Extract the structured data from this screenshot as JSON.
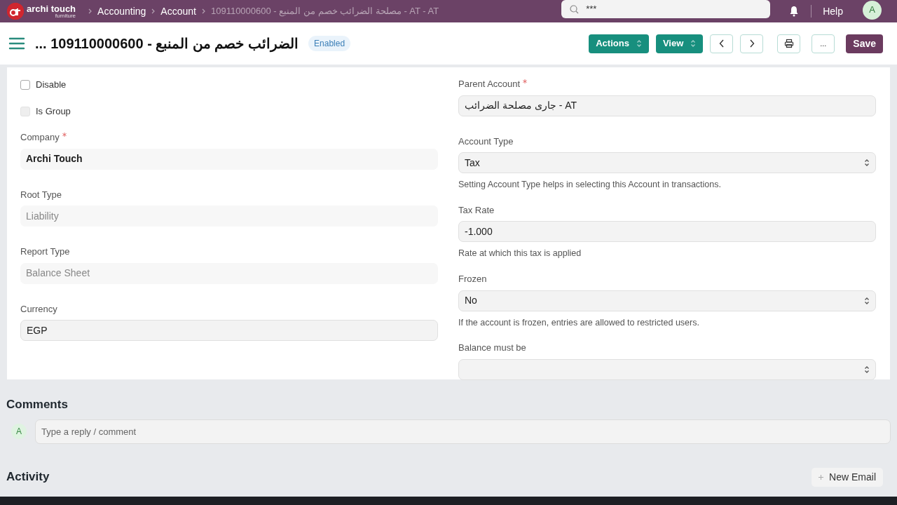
{
  "navbar": {
    "logo_text": "archi touch",
    "logo_subtext": "furniture",
    "breadcrumbs": [
      {
        "label": "Accounting",
        "current": false
      },
      {
        "label": "Account",
        "current": false
      },
      {
        "label": "109110000600 - مصلحة الضرائب خصم من المنبع - AT - AT",
        "current": true
      }
    ],
    "search": {
      "value": "***"
    },
    "help": "Help",
    "avatar": "A"
  },
  "header": {
    "title": "... الضرائب خصم من المنبع - 109110000600",
    "status": "Enabled",
    "buttons": [
      {
        "label": "Actions",
        "kind": "dropdown"
      },
      {
        "label": "View",
        "kind": "dropdown"
      },
      {
        "kind": "prev"
      },
      {
        "kind": "next"
      },
      {
        "kind": "print"
      },
      {
        "label": "...",
        "kind": "more"
      },
      {
        "label": "Save",
        "kind": "primary"
      }
    ]
  },
  "left_fields": [
    {
      "kind": "check",
      "label": "Disable",
      "checked": false,
      "disabled": false
    },
    {
      "kind": "check",
      "label": "Is Group",
      "checked": false,
      "disabled": true
    },
    {
      "kind": "link",
      "label": "Company",
      "required": true,
      "value": "Archi Touch"
    },
    {
      "kind": "readonly",
      "label": "Root Type",
      "value": "Liability"
    },
    {
      "kind": "readonly",
      "label": "Report Type",
      "value": "Balance Sheet"
    },
    {
      "kind": "data",
      "label": "Currency",
      "value": "EGP"
    }
  ],
  "right_fields": [
    {
      "kind": "data",
      "label": "Parent Account",
      "required": true,
      "value": "جارى مصلحة الضرائب - AT"
    },
    {
      "kind": "select",
      "label": "Account Type",
      "value": "Tax",
      "description": "Setting Account Type helps in selecting this Account in transactions."
    },
    {
      "kind": "data",
      "label": "Tax Rate",
      "value": "-1.000",
      "description": "Rate at which this tax is applied"
    },
    {
      "kind": "select",
      "label": "Frozen",
      "value": "No",
      "description": "If the account is frozen, entries are allowed to restricted users."
    },
    {
      "kind": "select",
      "label": "Balance must be"
    }
  ],
  "comments": {
    "title": "Comments",
    "avatar": "A",
    "placeholder": "Type a reply / comment"
  },
  "activity": {
    "title": "Activity",
    "new_email": "New Email"
  }
}
